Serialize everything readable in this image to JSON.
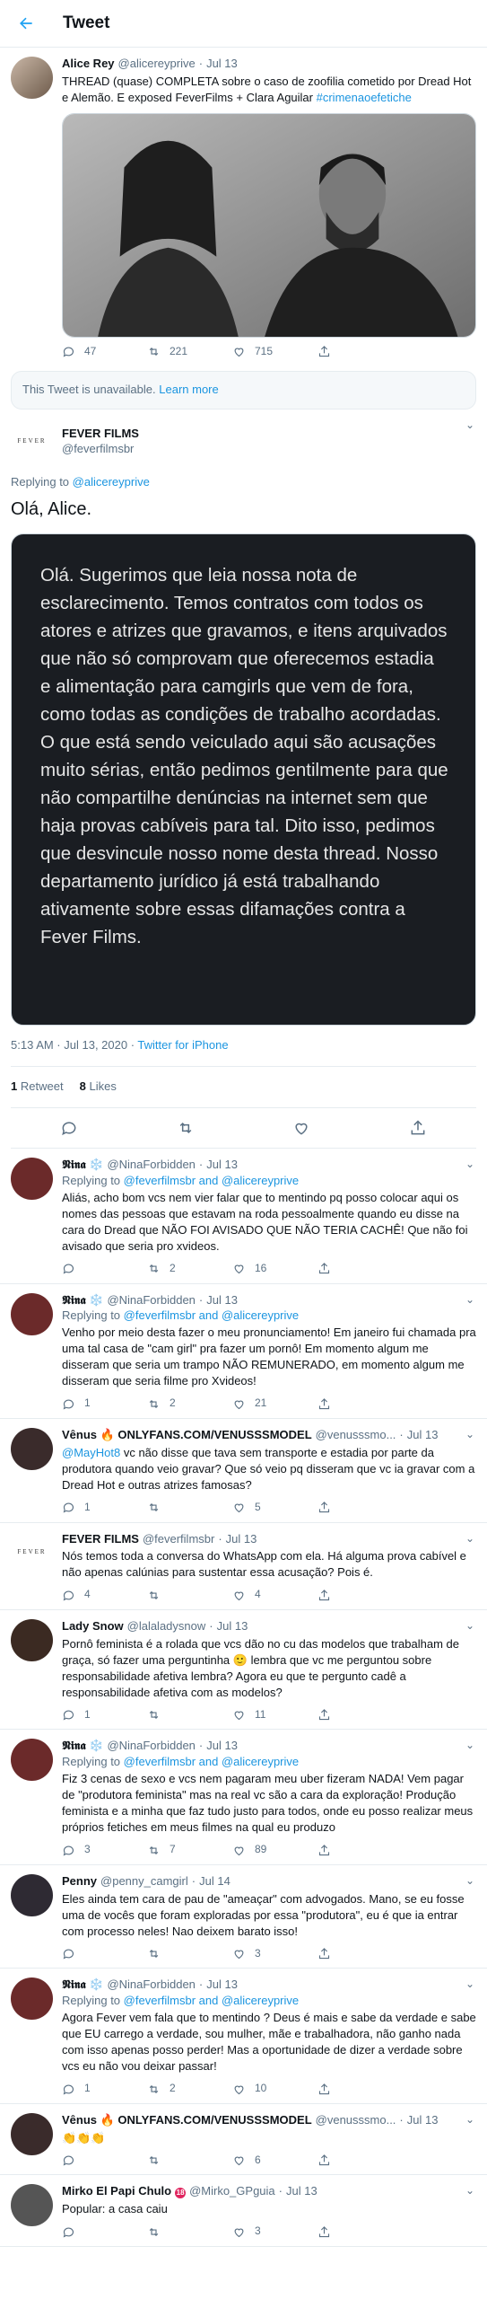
{
  "header": {
    "title": "Tweet"
  },
  "root_tweet": {
    "name": "Alice Rey",
    "handle": "@alicereyprive",
    "time": "Jul 13",
    "text": "THREAD (quase) COMPLETA sobre o caso de zoofilia cometido por Dread Hot e Alemão. E exposed FeverFilms + Clara Aguilar",
    "hashtag": "#crimenaoefetiche",
    "replies": "47",
    "retweets": "221",
    "likes": "715"
  },
  "unavailable": {
    "text": "This Tweet is unavailable.",
    "link": "Learn more"
  },
  "main": {
    "name": "FEVER FILMS",
    "handle": "@feverfilmsbr",
    "logo_text": "FEVER",
    "replying_prefix": "Replying to",
    "replying_to": "@alicereyprive",
    "text": "Olá, Alice.",
    "image_text": "Olá. Sugerimos que leia nossa nota de esclarecimento. Temos contratos com todos os atores e atrizes que gravamos, e itens arquivados que não só comprovam que oferecemos estadia e alimentação para camgirls que vem de fora, como todas as condições de trabalho acordadas. O que está sendo veiculado aqui são acusações muito sérias, então pedimos gentilmente para que não compartilhe denúncias na internet sem que haja provas cabíveis para tal. Dito isso, pedimos que desvincule nosso nome desta thread. Nosso departamento jurídico já está trabalhando ativamente sobre essas difamações contra a Fever Films.",
    "timestamp": "5:13 AM · Jul 13, 2020 · ",
    "source": "Twitter for iPhone",
    "retweets_count": "1",
    "retweets_label": "Retweet",
    "likes_count": "8",
    "likes_label": "Likes"
  },
  "replies": [
    {
      "name": "𝕹𝖎𝖓𝖆 ❄️",
      "handle": "@NinaForbidden",
      "time": "Jul 13",
      "replying_prefix": "Replying to",
      "replying_to": "@feverfilmsbr and @alicereyprive",
      "text": "Aliás, acho bom vcs nem vier falar que to mentindo pq posso colocar aqui os nomes das pessoas que estavam na roda pessoalmente quando eu disse na cara do Dread que NÃO FOI AVISADO QUE NÃO TERIA CACHÊ! Que não foi avisado que seria pro xvideos.",
      "c_replies": "",
      "c_retweets": "2",
      "c_likes": "16",
      "avatar_color": "#6b2a2a"
    },
    {
      "name": "𝕹𝖎𝖓𝖆 ❄️",
      "handle": "@NinaForbidden",
      "time": "Jul 13",
      "replying_prefix": "Replying to",
      "replying_to": "@feverfilmsbr and @alicereyprive",
      "text": "Venho por meio desta fazer o meu pronunciamento! Em janeiro fui chamada pra uma tal casa de \"cam girl\" pra fazer um pornô! Em momento algum me disseram que seria um trampo NÃO REMUNERADO, em momento algum me disseram que seria filme pro Xvideos!",
      "c_replies": "1",
      "c_retweets": "2",
      "c_likes": "21",
      "avatar_color": "#6b2a2a"
    },
    {
      "name": "Vênus 🔥 ONLYFANS.COM/VENUSSSMODEL",
      "handle": "@venusssmo...",
      "time": "Jul 13",
      "replying_prefix": "",
      "replying_to": "",
      "mention": "@MayHot8",
      "text": " vc não disse que tava sem transporte e estadia por parte da produtora quando veio gravar? Que só veio pq disseram que vc ia gravar com a Dread Hot e outras atrizes famosas?",
      "c_replies": "1",
      "c_retweets": "",
      "c_likes": "5",
      "avatar_color": "#3a2b2b"
    },
    {
      "name": "FEVER FILMS",
      "handle": "@feverfilmsbr",
      "time": "Jul 13",
      "replying_prefix": "",
      "replying_to": "",
      "text": "Nós temos toda a conversa do WhatsApp com ela. Há alguma prova cabível e não apenas calúnias para sustentar essa acusação? Pois é.",
      "c_replies": "4",
      "c_retweets": "",
      "c_likes": "4",
      "avatar_color": "#ffffff"
    },
    {
      "name": "Lady Snow",
      "handle": "@lalaladysnow",
      "time": "Jul 13",
      "replying_prefix": "",
      "replying_to": "",
      "text": "Pornô feminista é a rolada que vcs dão no cu das modelos que trabalham de graça, só fazer uma perguntinha 🙂 lembra que vc me perguntou sobre responsabilidade afetiva lembra? Agora eu que te pergunto cadê a responsabilidade afetiva com as modelos?",
      "c_replies": "1",
      "c_retweets": "",
      "c_likes": "11",
      "avatar_color": "#3b2a22"
    },
    {
      "name": "𝕹𝖎𝖓𝖆 ❄️",
      "handle": "@NinaForbidden",
      "time": "Jul 13",
      "replying_prefix": "Replying to",
      "replying_to": "@feverfilmsbr and @alicereyprive",
      "text": "Fiz 3 cenas de sexo e vcs nem pagaram meu uber fizeram NADA! Vem pagar de \"produtora feminista\" mas na real vc são a cara da exploração! Produção feminista e a minha que faz tudo justo para todos, onde eu posso realizar meus próprios fetiches em meus filmes na qual eu produzo",
      "c_replies": "3",
      "c_retweets": "7",
      "c_likes": "89",
      "avatar_color": "#6b2a2a"
    },
    {
      "name": "Penny",
      "handle": "@penny_camgirl",
      "time": "Jul 14",
      "replying_prefix": "",
      "replying_to": "",
      "text": "Eles ainda tem cara de pau de \"ameaçar\" com advogados. Mano, se eu fosse uma de vocês que foram exploradas por essa \"produtora\", eu é que ia entrar com processo neles! Nao deixem barato isso!",
      "c_replies": "",
      "c_retweets": "",
      "c_likes": "3",
      "avatar_color": "#2e2a33"
    },
    {
      "name": "𝕹𝖎𝖓𝖆 ❄️",
      "handle": "@NinaForbidden",
      "time": "Jul 13",
      "replying_prefix": "Replying to",
      "replying_to": "@feverfilmsbr and @alicereyprive",
      "text": "Agora Fever vem fala que to mentindo ? Deus é mais e sabe da verdade e sabe que EU carrego a verdade, sou mulher, mãe e trabalhadora, não ganho nada com isso apenas posso perder! Mas a oportunidade de dizer a verdade sobre vcs eu não vou deixar passar!",
      "c_replies": "1",
      "c_retweets": "2",
      "c_likes": "10",
      "avatar_color": "#6b2a2a"
    },
    {
      "name": "Vênus 🔥 ONLYFANS.COM/VENUSSSMODEL",
      "handle": "@venusssmo...",
      "time": "Jul 13",
      "replying_prefix": "",
      "replying_to": "",
      "text": "👏👏👏",
      "c_replies": "",
      "c_retweets": "",
      "c_likes": "6",
      "avatar_color": "#3a2b2b"
    },
    {
      "name": "Mirko El Papi Chulo",
      "handle": "@Mirko_GPguia",
      "time": "Jul 13",
      "replying_prefix": "",
      "replying_to": "",
      "badge": "18",
      "text": "Popular: a casa caiu",
      "c_replies": "",
      "c_retweets": "",
      "c_likes": "3",
      "avatar_color": "#555555"
    }
  ]
}
